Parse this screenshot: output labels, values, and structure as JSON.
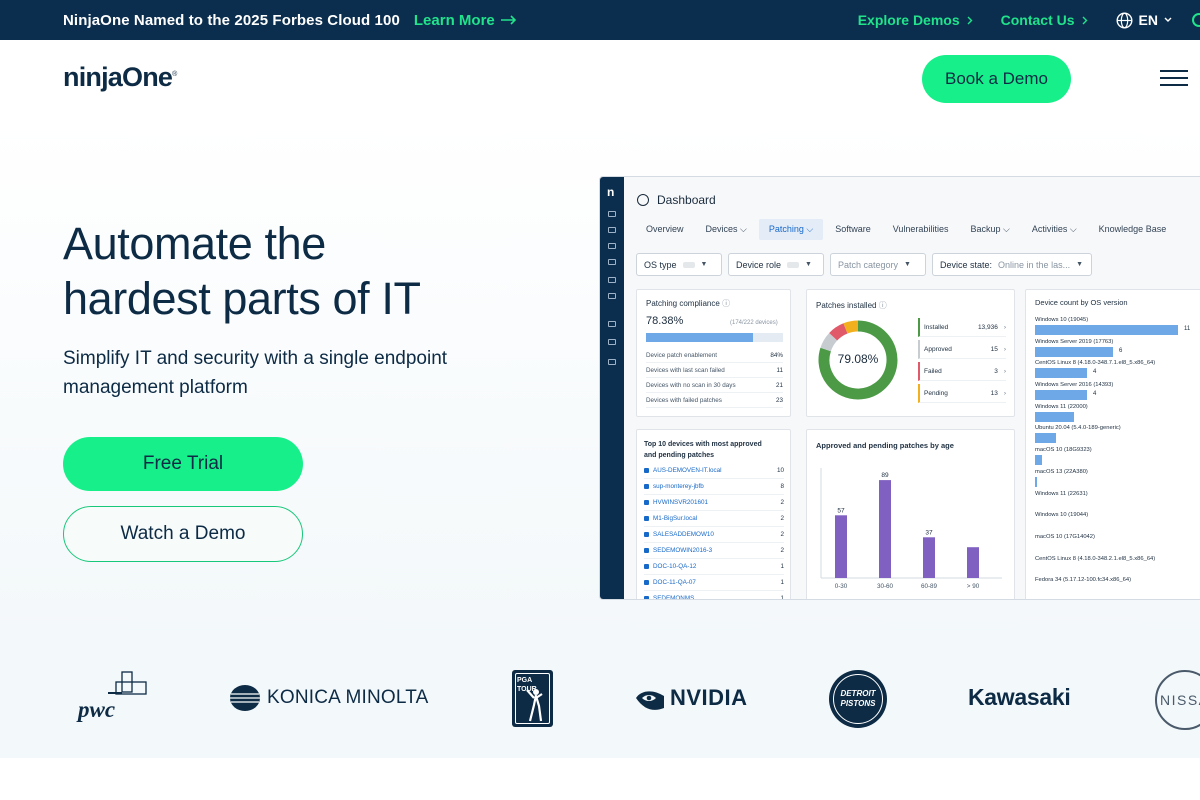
{
  "topbar": {
    "announcement": "NinjaOne Named to the 2025 Forbes Cloud 100",
    "learn_more": "Learn More",
    "explore_demos": "Explore Demos",
    "contact_us": "Contact Us",
    "language": "EN"
  },
  "header": {
    "logo": "ninjaOne",
    "book_demo": "Book a Demo"
  },
  "hero": {
    "title_line1": "Automate the",
    "title_line2": "hardest parts of IT",
    "subtitle": "Simplify IT and security with a single endpoint management platform",
    "free_trial": "Free Trial",
    "watch_demo": "Watch a Demo"
  },
  "dashboard": {
    "rail_logo": "n",
    "title": "Dashboard",
    "tabs": [
      "Overview",
      "Devices",
      "Patching",
      "Software",
      "Vulnerabilities",
      "Backup",
      "Activities",
      "Knowledge Base"
    ],
    "active_tab": "Patching",
    "filters": {
      "os_type": "OS type",
      "device_role": "Device role",
      "patch_category": "Patch category",
      "device_state_label": "Device state:",
      "device_state_value": "Online in the las..."
    },
    "compliance": {
      "title": "Patching compliance",
      "value": "78.38%",
      "count": "(174/222 devices)",
      "fraction": 0.7838,
      "rows": [
        {
          "label": "Device patch enablement",
          "value": "84%"
        },
        {
          "label": "Devices with last scan failed",
          "value": "11"
        },
        {
          "label": "Devices with no scan in 30 days",
          "value": "21"
        },
        {
          "label": "Devices with failed patches",
          "value": "23"
        }
      ]
    },
    "installed": {
      "title": "Patches installed",
      "center": "79.08%",
      "items": [
        {
          "label": "Installed",
          "value": "13,936",
          "color": "#4c9a46"
        },
        {
          "label": "Approved",
          "value": "15",
          "color": "#c7ccd1"
        },
        {
          "label": "Failed",
          "value": "3",
          "color": "#e05a6a"
        },
        {
          "label": "Pending",
          "value": "13",
          "color": "#f2b01e"
        }
      ]
    },
    "top10": {
      "title_line1": "Top 10 devices with most approved",
      "title_line2": "and pending patches",
      "rows": [
        {
          "name": "AUS-DEMOVEN-IT.local",
          "value": "10"
        },
        {
          "name": "sup-monterey-jbfb",
          "value": "8"
        },
        {
          "name": "HVWINSVR201601",
          "value": "2"
        },
        {
          "name": "M1-BigSur.local",
          "value": "2"
        },
        {
          "name": "SALESADDEMOW10",
          "value": "2"
        },
        {
          "name": "SEDEMOWIN2016-3",
          "value": "2"
        },
        {
          "name": "DOC-10-QA-12",
          "value": "1"
        },
        {
          "name": "DOC-11-QA-07",
          "value": "1"
        },
        {
          "name": "SEDEMONMS",
          "value": "1"
        }
      ]
    },
    "os_count": {
      "title": "Device count by OS version",
      "items": [
        {
          "label": "Windows 10 (19045)",
          "value": "11",
          "n": 11
        },
        {
          "label": "Windows Server 2019 (17763)",
          "value": "6",
          "n": 6
        },
        {
          "label": "CentOS Linux 8 (4.18.0-348.7.1.el8_5.x86_64)",
          "value": "4",
          "n": 4
        },
        {
          "label": "Windows Server 2016 (14393)",
          "value": "4",
          "n": 4
        },
        {
          "label": "Windows 11 (22000)",
          "value": "",
          "n": 3
        },
        {
          "label": "Ubuntu 20.04 (5.4.0-189-generic)",
          "value": "",
          "n": 1.6
        },
        {
          "label": "macOS 10 (18G9323)",
          "value": "",
          "n": 0.55
        },
        {
          "label": "macOS 13 (22A380)",
          "value": "",
          "n": 0.15
        },
        {
          "label": "Windows 11 (22631)",
          "value": "",
          "n": 0
        },
        {
          "label": "Windows 10 (19044)",
          "value": "",
          "n": 0
        },
        {
          "label": "macOS 10 (17G14042)",
          "value": "",
          "n": 0
        },
        {
          "label": "CentOS Linux 8 (4.18.0-348.2.1.el8_5.x86_64)",
          "value": "",
          "n": 0
        },
        {
          "label": "Fedora 34 (5.17.12-100.fc34.x86_64)",
          "value": "",
          "n": 0
        }
      ]
    },
    "age_chart": {
      "title": "Approved and pending patches by age",
      "chart_data": {
        "type": "bar",
        "categories": [
          "0-30",
          "30-60",
          "60-89",
          "> 90"
        ],
        "values": [
          57,
          89,
          37,
          28
        ],
        "labels": [
          "57",
          "89",
          "37",
          ""
        ],
        "ylim": [
          0,
          100
        ],
        "color": "#8061c2"
      }
    }
  },
  "logos": [
    "pwc",
    "KONICA MINOLTA",
    "PGA TOUR",
    "NVIDIA",
    "DETROIT PISTONS",
    "Kawasaki",
    "NISSAN"
  ]
}
